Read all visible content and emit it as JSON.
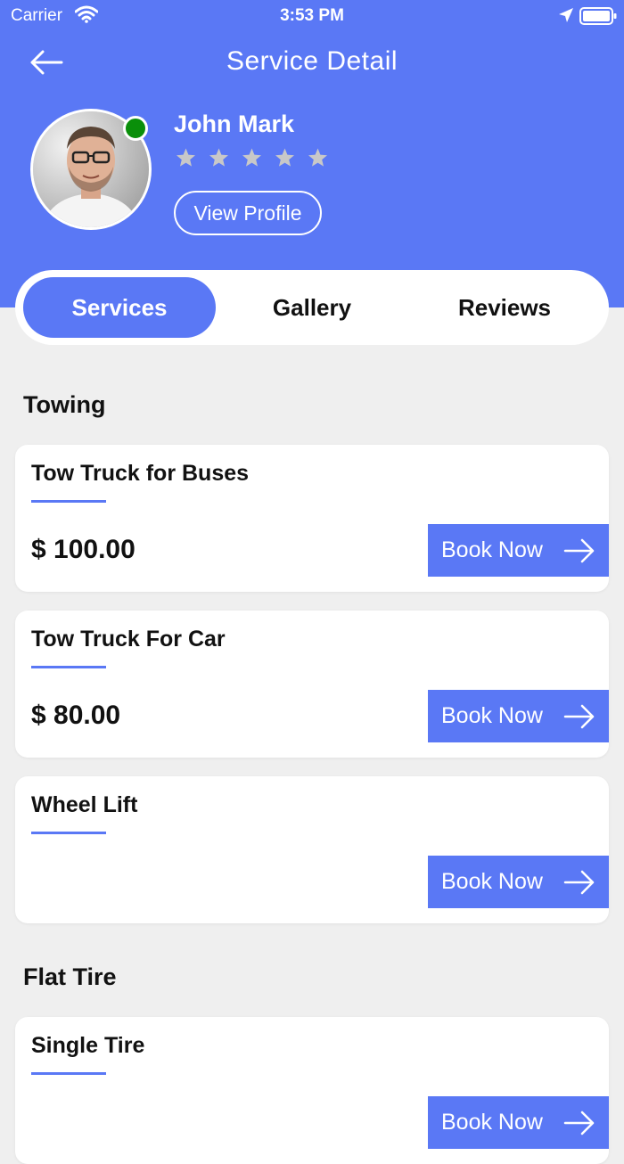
{
  "status_bar": {
    "carrier": "Carrier",
    "time": "3:53 PM"
  },
  "header": {
    "title": "Service Detail"
  },
  "profile": {
    "name": "John Mark",
    "rating": 0,
    "max_rating": 5,
    "view_profile_label": "View Profile",
    "online": true
  },
  "tabs": [
    {
      "label": "Services",
      "active": true
    },
    {
      "label": "Gallery",
      "active": false
    },
    {
      "label": "Reviews",
      "active": false
    }
  ],
  "sections": [
    {
      "title": "Towing",
      "items": [
        {
          "name": "Tow Truck for Buses",
          "price": "$ 100.00",
          "button": "Book Now"
        },
        {
          "name": "Tow Truck For Car",
          "price": "$ 80.00",
          "button": "Book Now"
        },
        {
          "name": "Wheel Lift",
          "price": "",
          "button": "Book Now"
        }
      ]
    },
    {
      "title": "Flat Tire",
      "items": [
        {
          "name": "Single Tire",
          "price": "",
          "button": "Book Now"
        }
      ]
    }
  ],
  "colors": {
    "primary": "#5a78f5",
    "online": "#0a8f0a",
    "background": "#efefef",
    "star": "#c8c8c8"
  }
}
